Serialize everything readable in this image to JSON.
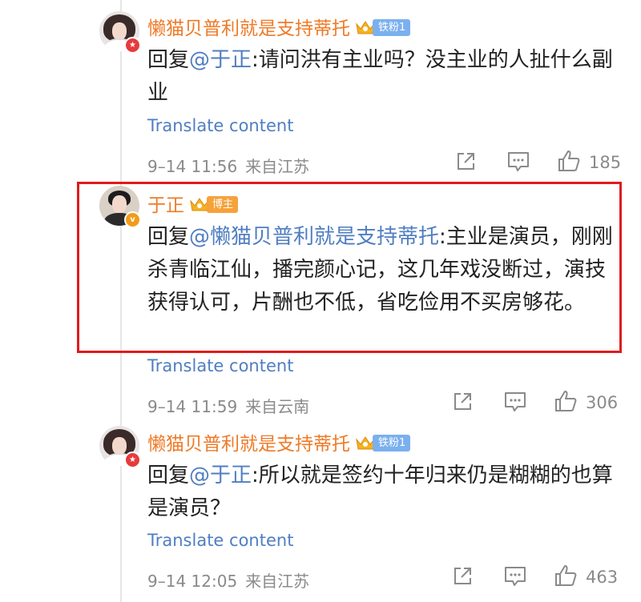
{
  "comments": [
    {
      "username": "懒猫贝普利就是支持蒂托",
      "level_badge": "铁粉1",
      "reply_prefix": "回复",
      "mention": "@于正",
      "text": ":请问洪有主业吗？没主业的人扯什么副业",
      "translate_label": "Translate content",
      "timestamp": "9–14 11:56",
      "source": "来自江苏",
      "like_count": "185"
    },
    {
      "username": "于正",
      "level_badge": "博主",
      "reply_prefix": "回复",
      "mention": "@懒猫贝普利就是支持蒂托",
      "text": ":主业是演员，刚刚杀青临江仙，播完颜心记，这几年戏没断过，演技获得认可，片酬也不低，省吃俭用不买房够花。",
      "translate_label": "Translate content",
      "timestamp": "9–14 11:59",
      "source": "来自云南",
      "like_count": "306"
    },
    {
      "username": "懒猫贝普利就是支持蒂托",
      "level_badge": "铁粉1",
      "reply_prefix": "回复",
      "mention": "@于正",
      "text": ":所以就是签约十年归来仍是糊糊的也算是演员？",
      "translate_label": "Translate content",
      "timestamp": "9–14 12:05",
      "source": "来自江苏",
      "like_count": "463"
    }
  ],
  "icons": {
    "share": "share-icon",
    "comment": "comment-icon",
    "like": "like-icon",
    "crown": "crown-icon"
  },
  "colors": {
    "username": "#ef7a26",
    "link": "#4f7ec2",
    "meta": "#8a8a8a",
    "highlight": "#e01b1b",
    "fan_badge": "#7bb0ee",
    "host_badge": "#f6a23a"
  }
}
